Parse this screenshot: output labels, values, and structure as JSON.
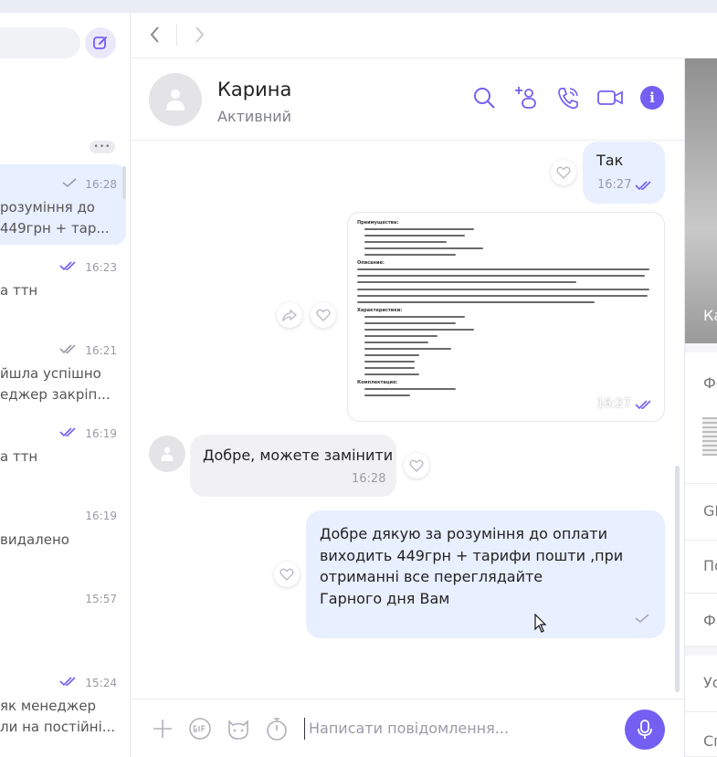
{
  "chat_list": {
    "items": [
      {
        "time": "16:28",
        "status": "read-grey",
        "line1": "розуміння до",
        "line2": "449грн + тар...",
        "active": true
      },
      {
        "time": "16:23",
        "status": "read-blue",
        "line1": "а ттн",
        "line2": ""
      },
      {
        "time": "16:21",
        "status": "read-grey",
        "line1": "йшла успішно",
        "line2": "еджер закріп..."
      },
      {
        "time": "16:19",
        "status": "read-blue",
        "line1": "а ттн",
        "line2": ""
      },
      {
        "time": "16:19",
        "status": "",
        "line1": "видалено",
        "line2": ""
      },
      {
        "time": "15:57",
        "status": "",
        "line1": "",
        "line2": ""
      },
      {
        "time": "15:24",
        "status": "read-blue",
        "line1": "як менеджер",
        "line2": "ли на постійні..."
      }
    ]
  },
  "header": {
    "name": "Карина",
    "status": "Активний"
  },
  "messages": [
    {
      "dir": "out",
      "text": "Так",
      "time": "16:27",
      "status": "read"
    },
    {
      "dir": "out",
      "type": "image",
      "time": "16:27",
      "status": "read",
      "doc": {
        "h1": "Преимущества:",
        "h2": "Описание:",
        "h3": "Характеристики:",
        "h4": "Комплектация:"
      }
    },
    {
      "dir": "in",
      "text": "Добре, можете замінити",
      "time": "16:28"
    },
    {
      "dir": "out",
      "text": "Добре дякую за розуміння до оплати\nвиходить 449грн + тарифи пошти ,при\nотриманні все переглядайте\nГарного дня Вам",
      "status": "sent"
    }
  ],
  "composer": {
    "placeholder": "Написати повідомлення..."
  },
  "info_panel": {
    "cover_name": "Ка",
    "sections": [
      "Фо",
      "GI",
      "По",
      "Фа",
      "Ус",
      "Сп"
    ]
  },
  "colors": {
    "accent": "#7360f2",
    "bubble_out": "#e8efff",
    "bubble_in": "#f1f1f4"
  }
}
